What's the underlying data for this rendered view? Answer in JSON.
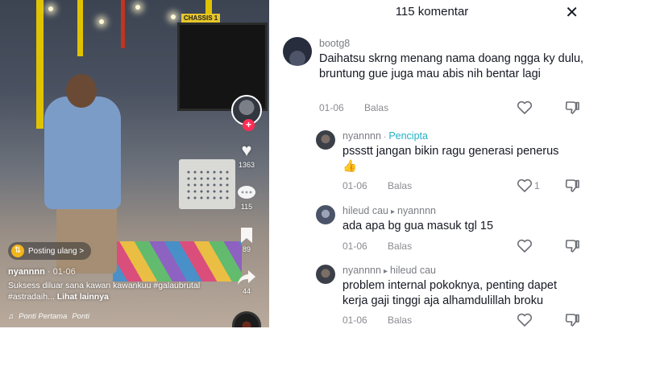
{
  "video": {
    "repost_label": "Posting ulang >",
    "author": "nyannnn",
    "date": "· 01-06",
    "caption": "Suksess diluar sana kawan kawankuu #galaubrutal #astradaih...",
    "more_label": "Lihat lainnya",
    "music": "Ponti Pertama",
    "music_suffix": "Ponti",
    "sign": "CHASSIS 1",
    "counts": {
      "likes": "1363",
      "comments": "115",
      "saves": "89",
      "shares": "44"
    }
  },
  "panel": {
    "title": "115 komentar",
    "close_glyph": "✕"
  },
  "comments": [
    {
      "username": "bootg8",
      "text": "Daihatsu skrng menang nama doang ngga ky dulu, bruntung gue juga mau abis nih bentar lagi",
      "date": "01-06",
      "reply_label": "Balas",
      "likes": ""
    },
    {
      "username": "nyannnn",
      "sep": "·",
      "badge": "Pencipta",
      "text": "pssstt jangan bikin ragu generasi penerus 👍",
      "date": "01-06",
      "reply_label": "Balas",
      "likes": "1"
    },
    {
      "username": "hileud cau",
      "arrow": "▸",
      "reply_to": "nyannnn",
      "text": "ada apa bg gua masuk tgl 15",
      "date": "01-06",
      "reply_label": "Balas",
      "likes": ""
    },
    {
      "username": "nyannnn",
      "arrow": "▸",
      "reply_to": "hileud cau",
      "text": "problem internal pokoknya, penting dapet kerja gaji tinggi aja alhamdulillah broku",
      "date": "01-06",
      "reply_label": "Balas",
      "likes": ""
    }
  ],
  "colors": {
    "creator_badge": "#22b1c4",
    "follow_plus": "#fe2c55",
    "text_primary": "#161823",
    "text_secondary": "#8a8b91"
  },
  "icons": {
    "heart": "heart-icon",
    "dislike": "thumbs-down-icon",
    "close": "close-icon",
    "comment": "comment-bubble-icon",
    "bookmark": "bookmark-icon",
    "share": "share-arrow-icon",
    "music": "music-note-icon",
    "repost": "repost-icon"
  }
}
